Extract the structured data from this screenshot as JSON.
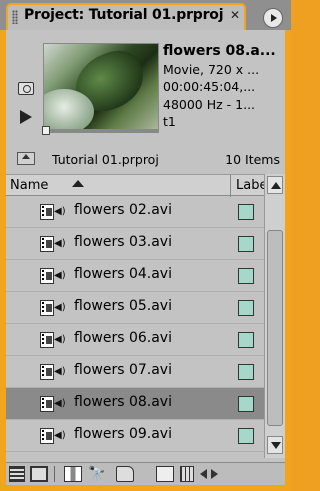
{
  "tab": {
    "title": "Project: Tutorial 01.prproj",
    "close_glyph": "✕"
  },
  "preview": {
    "clip_name": "flowers 08.a...",
    "line1": "Movie, 720 x ...",
    "line2": "00:00:45:04,...",
    "line3": "48000 Hz - 1...",
    "line4": "t1"
  },
  "pathbar": {
    "project_file": "Tutorial 01.prproj",
    "item_count": "10 Items"
  },
  "list": {
    "col_name": "Name",
    "col_label": "Label",
    "label_color": "#a6d8ca",
    "selected_index": 6,
    "rows": [
      {
        "name": "flowers 02.avi"
      },
      {
        "name": "flowers 03.avi"
      },
      {
        "name": "flowers 04.avi"
      },
      {
        "name": "flowers 05.avi"
      },
      {
        "name": "flowers 06.avi"
      },
      {
        "name": "flowers 07.avi"
      },
      {
        "name": "flowers 08.avi"
      },
      {
        "name": "flowers 09.avi"
      }
    ]
  },
  "toolbar": {
    "find_glyph": "🔭"
  },
  "colors": {
    "panel_border": "#f2a41c",
    "panel_bg": "#c3c3c3",
    "selected_row": "#8a8a8a"
  }
}
